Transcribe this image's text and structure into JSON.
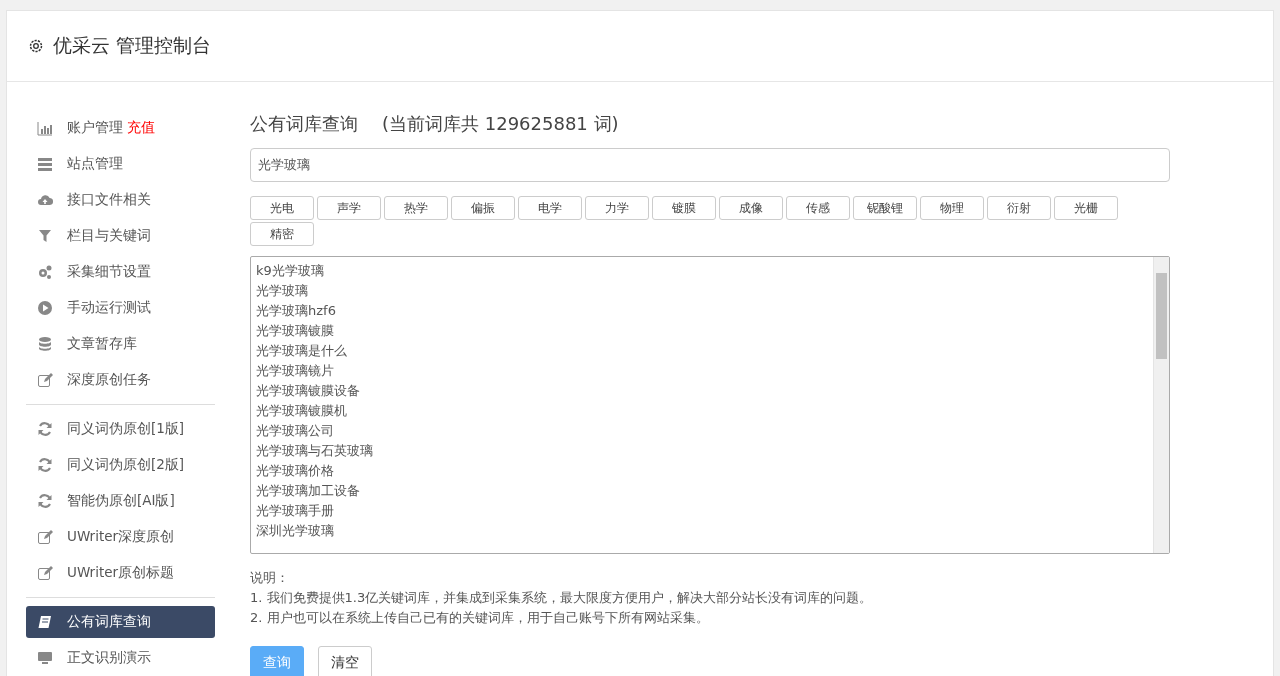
{
  "header": {
    "title": "优采云 管理控制台"
  },
  "sidebar": {
    "groups": [
      {
        "items": [
          {
            "label": "账户管理",
            "badge": "充值",
            "kind": "chart",
            "selected": false
          },
          {
            "label": "站点管理",
            "kind": "server",
            "selected": false
          },
          {
            "label": "接口文件相关",
            "kind": "cloud",
            "selected": false
          },
          {
            "label": "栏目与关键词",
            "kind": "filter",
            "selected": false
          },
          {
            "label": "采集细节设置",
            "kind": "gears",
            "selected": false
          },
          {
            "label": "手动运行测试",
            "kind": "play",
            "selected": false
          },
          {
            "label": "文章暂存库",
            "kind": "database",
            "selected": false
          },
          {
            "label": "深度原创任务",
            "kind": "edit",
            "selected": false
          }
        ]
      },
      {
        "items": [
          {
            "label": "同义词伪原创[1版]",
            "kind": "refresh",
            "selected": false
          },
          {
            "label": "同义词伪原创[2版]",
            "kind": "refresh",
            "selected": false
          },
          {
            "label": "智能伪原创[AI版]",
            "kind": "refresh",
            "selected": false
          },
          {
            "label": "UWriter深度原创",
            "kind": "edit",
            "selected": false
          },
          {
            "label": "UWriter原创标题",
            "kind": "edit",
            "selected": false
          }
        ]
      },
      {
        "items": [
          {
            "label": "公有词库查询",
            "kind": "book",
            "selected": true
          },
          {
            "label": "正文识别演示",
            "kind": "monitor",
            "selected": false
          }
        ]
      }
    ]
  },
  "main": {
    "title": "公有词库查询",
    "subtitle": "(当前词库共 129625881 词)",
    "search": {
      "value": "光学玻璃"
    },
    "tags": [
      "光电",
      "声学",
      "热学",
      "偏振",
      "电学",
      "力学",
      "镀膜",
      "成像",
      "传感",
      "铌酸锂",
      "物理",
      "衍射",
      "光栅",
      "精密"
    ],
    "results": [
      "k9光学玻璃",
      "光学玻璃",
      "光学玻璃hzf6",
      "光学玻璃镀膜",
      "光学玻璃是什么",
      "光学玻璃镜片",
      "光学玻璃镀膜设备",
      "光学玻璃镀膜机",
      "光学玻璃公司",
      "光学玻璃与石英玻璃",
      "光学玻璃价格",
      "光学玻璃加工设备",
      "光学玻璃手册",
      "深圳光学玻璃"
    ],
    "notes_title": "说明：",
    "notes": [
      "1. 我们免费提供1.3亿关键词库，并集成到采集系统，最大限度方便用户，解决大部分站长没有词库的问题。",
      "2. 用户也可以在系统上传自己已有的关键词库，用于自己账号下所有网站采集。"
    ],
    "buttons": [
      {
        "label": "查询",
        "kind": "primary"
      },
      {
        "label": "清空",
        "kind": "default"
      }
    ]
  }
}
